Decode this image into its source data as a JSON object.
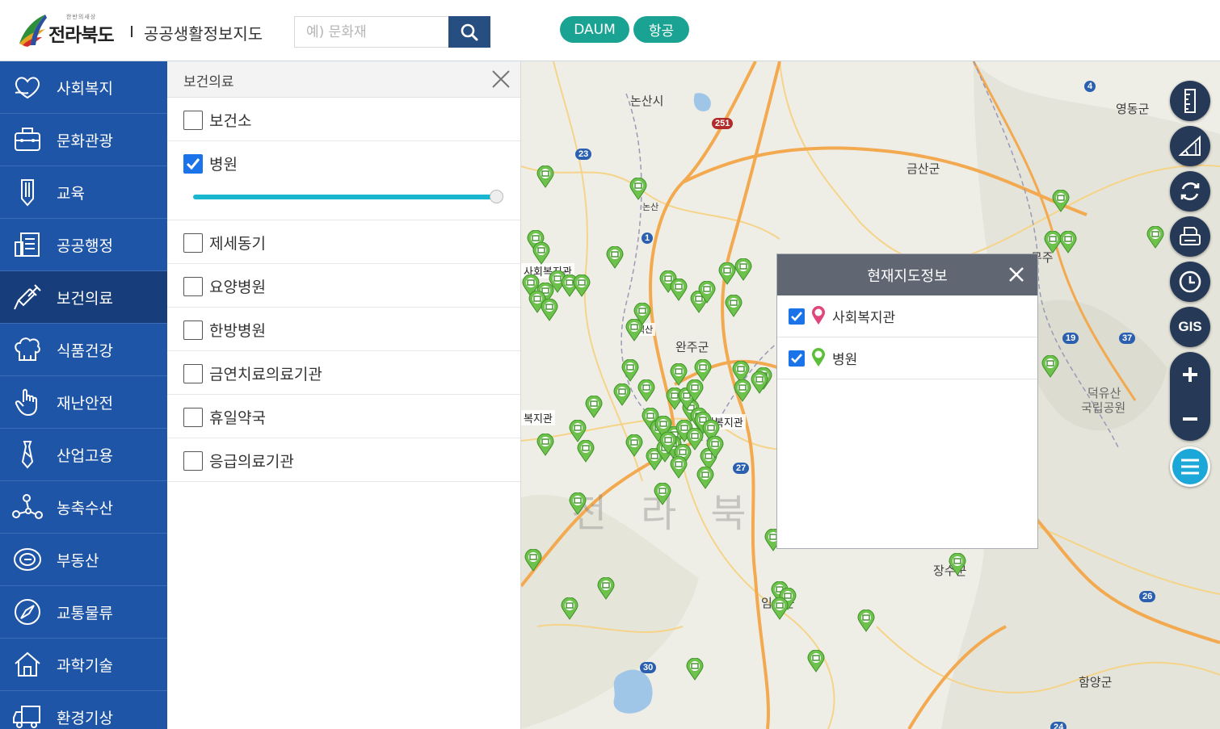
{
  "header": {
    "logo_small": "한반의새상",
    "logo_text": "전라북도",
    "site_title": "공공생활정보지도",
    "search_placeholder": "예) 문화재",
    "map_types": [
      "DAUM",
      "항공"
    ]
  },
  "sidebar": {
    "items": [
      {
        "label": "사회복지",
        "icon": "heart-hand-icon"
      },
      {
        "label": "문화관광",
        "icon": "suitcase-icon"
      },
      {
        "label": "교육",
        "icon": "pencil-icon"
      },
      {
        "label": "공공행정",
        "icon": "document-building-icon"
      },
      {
        "label": "보건의료",
        "icon": "syringe-icon",
        "active": true
      },
      {
        "label": "식품건강",
        "icon": "chef-hat-icon"
      },
      {
        "label": "재난안전",
        "icon": "hand-pointer-icon"
      },
      {
        "label": "산업고용",
        "icon": "tie-icon"
      },
      {
        "label": "농축수산",
        "icon": "molecule-icon"
      },
      {
        "label": "부동산",
        "icon": "coin-icon"
      },
      {
        "label": "교통물류",
        "icon": "compass-icon"
      },
      {
        "label": "과학기술",
        "icon": "house-icon"
      },
      {
        "label": "환경기상",
        "icon": "truck-icon"
      }
    ]
  },
  "panel": {
    "title": "보건의료",
    "options": [
      {
        "label": "보건소",
        "checked": false
      },
      {
        "label": "병원",
        "checked": true,
        "opacity": 1.0
      },
      {
        "label": "제세동기",
        "checked": false
      },
      {
        "label": "요양병원",
        "checked": false
      },
      {
        "label": "한방병원",
        "checked": false
      },
      {
        "label": "금연치료의료기관",
        "checked": false
      },
      {
        "label": "휴일약국",
        "checked": false
      },
      {
        "label": "응급의료기관",
        "checked": false
      }
    ]
  },
  "map": {
    "labels": [
      {
        "text": "논산시"
      },
      {
        "text": "금산군"
      },
      {
        "text": "영동군"
      },
      {
        "text": "완주군"
      },
      {
        "text": "무주"
      },
      {
        "text": "덕유산"
      },
      {
        "text": "국립공원"
      },
      {
        "text": "장수군"
      },
      {
        "text": "임실군"
      },
      {
        "text": "함양군"
      },
      {
        "text": "논산"
      }
    ],
    "poi_labels": [
      "사회복지관",
      "사회복지관",
      "복지관",
      "사회복지관",
      "익산"
    ],
    "watermark": "전라북도",
    "route_shields": [
      "251",
      "23",
      "1",
      "4",
      "19",
      "37",
      "27",
      "26",
      "30",
      "24"
    ]
  },
  "info_popup": {
    "title": "현재지도정보",
    "layers": [
      {
        "label": "사회복지관",
        "checked": true,
        "pin_color": "#e0457b"
      },
      {
        "label": "병원",
        "checked": true,
        "pin_color": "#5cbf3a"
      }
    ]
  },
  "tools": {
    "items": [
      "ruler-icon",
      "area-measure-icon",
      "refresh-icon",
      "print-icon",
      "history-clock-icon"
    ],
    "gis_label": "GIS"
  },
  "colors": {
    "nav_bg": "#1f55a6",
    "nav_active": "#173e7a",
    "accent_green": "#1aa392",
    "search_btn": "#264e80",
    "tool_bg": "#263a57"
  }
}
